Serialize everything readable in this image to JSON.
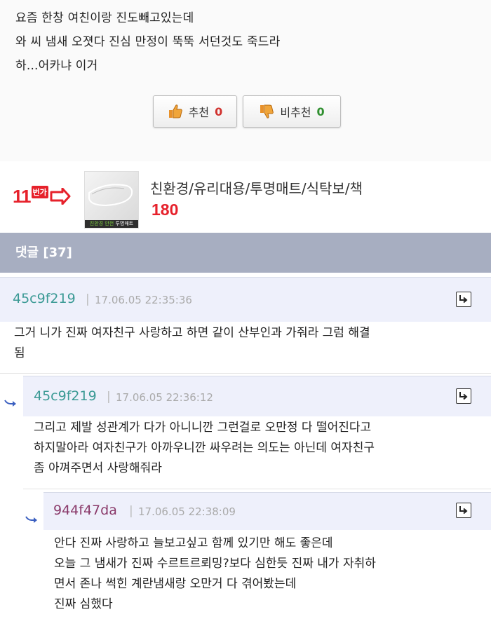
{
  "post": {
    "lines": [
      "요즘 한창 여친이랑 진도빼고있는데",
      "와 씨 냄새 오졋다 진심 만정이 뚝뚝 서던것도 죽드라",
      "하...어카냐 이거"
    ]
  },
  "votes": {
    "up_label": "추천",
    "up_count": "0",
    "down_label": "비추천",
    "down_count": "0"
  },
  "ad": {
    "logo_number": "11",
    "logo_text": "번가",
    "thumb_caption_green": "친환경 안전",
    "thumb_caption": " 투명매트",
    "title": "친환경/유리대용/투명매트/식탁보/책",
    "price": "180"
  },
  "comments_header": "댓글 [37]",
  "comments": [
    {
      "nick": "45c9f219",
      "date": "17.06.05 22:35:36",
      "lines": [
        "그거 니가 진짜 여자친구 사랑하고 하면 같이 산부인과 가줘라 그럼 해결",
        "됨"
      ]
    },
    {
      "nick": "45c9f219",
      "date": "17.06.05 22:36:12",
      "lines": [
        "그리고 제발 성관계가 다가 아니니깐 그런걸로 오만정 다 떨어진다고",
        "하지말아라 여자친구가 아까우니깐 싸우려는 의도는 아닌데 여자친구",
        "좀 아껴주면서 사랑해줘라"
      ]
    },
    {
      "nick": "944f47da",
      "date": "17.06.05 22:38:09",
      "lines": [
        "안다 진짜 사랑하고 늘보고싶고 함께 있기만 해도 좋은데",
        "오늘 그 냄새가 진짜 수르트르뢰밍?보다 심한듯 진짜 내가 자취하",
        "면서 존나 썩힌 계란냄새랑 오만거 다 겪어봤는데",
        "진짜 심했다"
      ]
    }
  ],
  "colors": {
    "header_bg": "#a7aec1",
    "nick_teal": "#3b9a95",
    "nick_purple": "#8a3a6a",
    "vote_up": "#d0312d",
    "vote_down": "#2f8f2f",
    "ad_red": "#e6212b"
  }
}
